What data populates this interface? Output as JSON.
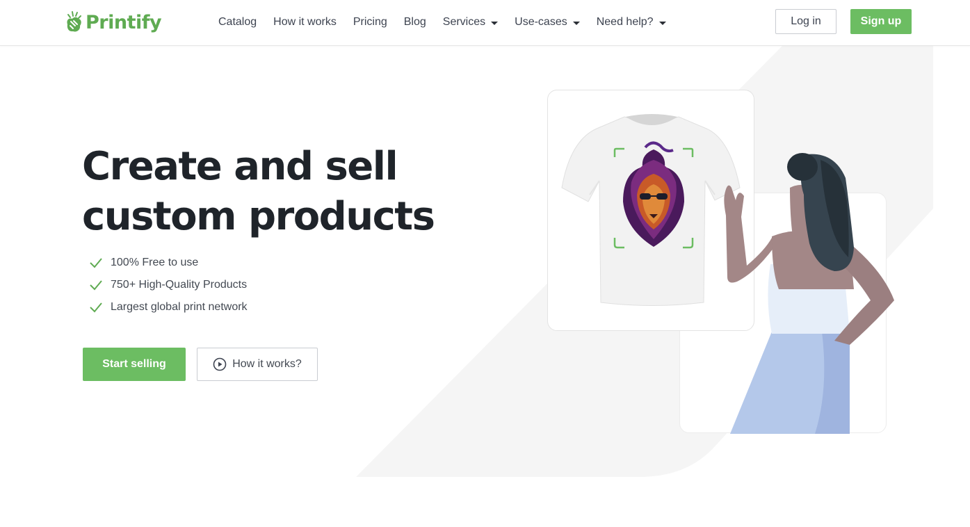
{
  "brand": {
    "name": "Printify",
    "color": "#5fab52"
  },
  "nav": {
    "items": [
      {
        "label": "Catalog",
        "dropdown": false
      },
      {
        "label": "How it works",
        "dropdown": false
      },
      {
        "label": "Pricing",
        "dropdown": false
      },
      {
        "label": "Blog",
        "dropdown": false
      },
      {
        "label": "Services",
        "dropdown": true
      },
      {
        "label": "Use-cases",
        "dropdown": true
      },
      {
        "label": "Need help?",
        "dropdown": true
      }
    ],
    "login_label": "Log in",
    "signup_label": "Sign up"
  },
  "hero": {
    "headline_line1": "Create and sell",
    "headline_line2": "custom products",
    "features": [
      "100% Free to use",
      "750+ High-Quality Products",
      "Largest global print network"
    ],
    "primary_cta": "Start selling",
    "secondary_cta": "How it works?"
  },
  "colors": {
    "accent": "#6cbd62",
    "text": "#1f242a",
    "muted_text": "#434952",
    "bg_shape": "#f5f5f5"
  },
  "icons": {
    "logo": "printify-logo-icon",
    "check": "check-icon",
    "play": "play-circle-icon",
    "caret": "caret-down-icon"
  }
}
